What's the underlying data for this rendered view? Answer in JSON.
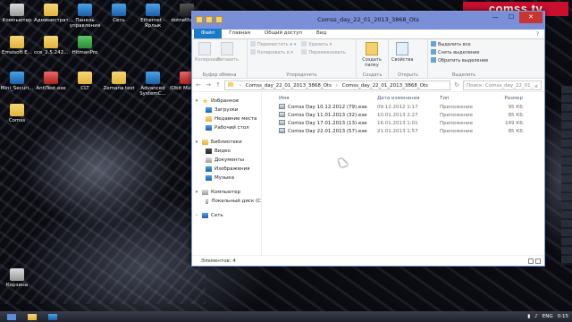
{
  "logo_text": "comss.tv",
  "desktop_icons": [
    {
      "label": "Компьютер",
      "color": "gray"
    },
    {
      "label": "Администрат...",
      "color": "folder"
    },
    {
      "label": "Панель управления",
      "color": "blue"
    },
    {
      "label": "Сеть",
      "color": "blue"
    },
    {
      "label": "Ethernet - Ярлык",
      "color": "blue"
    },
    {
      "label": "dotnetfx35...",
      "color": "dark"
    },
    {
      "label": "Emsisoft E...",
      "color": "folder"
    },
    {
      "label": "cce_2.5.242...",
      "color": "folder"
    },
    {
      "label": "HitmanPro",
      "color": "green"
    },
    {
      "label": "Mini_Securi...",
      "color": "blue"
    },
    {
      "label": "AntiTest.exe",
      "color": "red"
    },
    {
      "label": "CLT",
      "color": "folder"
    },
    {
      "label": "Zemana test",
      "color": "folder"
    },
    {
      "label": "Advanced SystemC...",
      "color": "blue"
    },
    {
      "label": "IObit Malwa...",
      "color": "red"
    },
    {
      "label": "Comss",
      "color": "folder"
    },
    {
      "label": "Корзина",
      "color": "gray"
    }
  ],
  "window": {
    "title": "Comss_day_22_01_2013_3868_Ots",
    "controls": {
      "minimize": "—",
      "maximize": "☐",
      "close": "✕"
    },
    "tabs": [
      {
        "label": "Файл"
      },
      {
        "label": "Главная"
      },
      {
        "label": "Общий доступ"
      },
      {
        "label": "Вид"
      }
    ],
    "help_icon": "?",
    "ribbon": {
      "copy": "Копировать",
      "paste": "Вставить",
      "clipboard_group": "Буфер обмена",
      "move_to": "Переместить в ▾",
      "copy_to": "Копировать в ▾",
      "delete": "Удалить ▾",
      "rename": "Переименовать",
      "organize_group": "Упорядочить",
      "new_folder": "Создать папку",
      "create_group": "Создать",
      "properties": "Свойства",
      "open_group": "Открыть",
      "select_all": "Выделить все",
      "select_none": "Снять выделение",
      "invert_selection": "Обратить выделение",
      "select_group": "Выделить"
    },
    "address": {
      "parts": [
        "Comss_day_22_01_2013_3868_Ots",
        "Comss_day_22_01_2013_3868_Ots"
      ],
      "search_placeholder": "Поиск: Comss_day_22_01_..."
    },
    "nav_pane": {
      "favorites": "Избранное",
      "favorites_items": [
        "Загрузки",
        "Недавние места",
        "Рабочий стол"
      ],
      "libraries": "Библиотеки",
      "libraries_items": [
        "Видео",
        "Документы",
        "Изображения",
        "Музыка"
      ],
      "computer": "Компьютер",
      "computer_items": [
        "Локальный диск (C"
      ],
      "network": "Сеть"
    },
    "columns": [
      "Имя",
      "Дата изменения",
      "Тип",
      "Размер"
    ],
    "files": [
      {
        "name": "Comss Day 10.12.2012 (79).exe",
        "date": "09.12.2012 1:17",
        "type": "Приложение",
        "size": "95 КБ"
      },
      {
        "name": "Comss Day 11.01.2013 (32).exe",
        "date": "10.01.2013 2:27",
        "type": "Приложение",
        "size": "85 КБ"
      },
      {
        "name": "Comss Day 17.01.2013 (13).exe",
        "date": "16.01.2013 1:01",
        "type": "Приложение",
        "size": "149 КБ"
      },
      {
        "name": "Comss Day 22.01.2013 (57).exe",
        "date": "21.01.2013 1:57",
        "type": "Приложение",
        "size": "85 КБ"
      }
    ],
    "status": "Элементов: 4"
  },
  "taskbar": {
    "tray_lang": "ENG",
    "tray_time": "0:15"
  }
}
